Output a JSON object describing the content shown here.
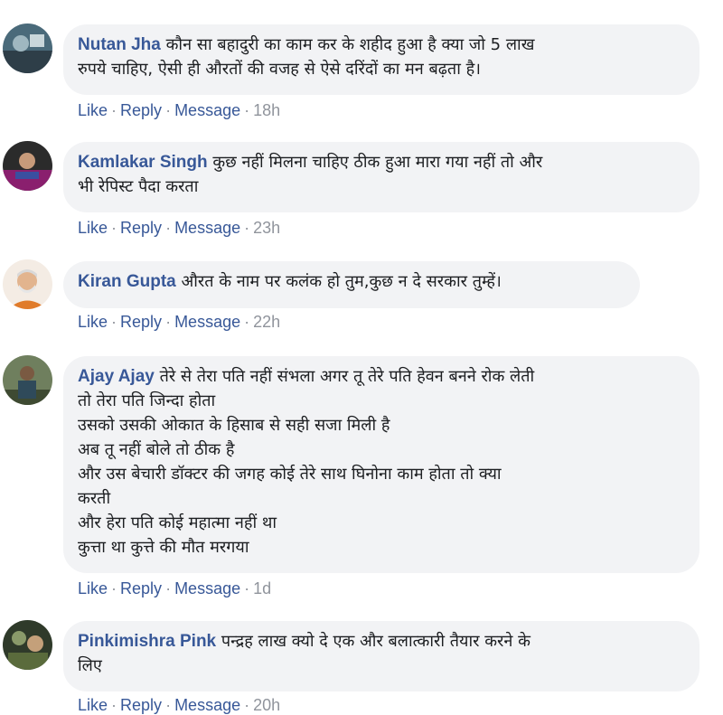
{
  "comments": [
    {
      "author": "Nutan Jha",
      "text": "कौन सा बहादुरी का काम कर के शहीद हुआ है क्या जो 5 लाख\nरुपये चाहिए, ऐसी ही औरतों की वजह से ऐसे दरिंदों का मन बढ़ता है।",
      "like": "Like",
      "reply": "Reply",
      "message": "Message",
      "time": "18h",
      "avatar_icon": "user-avatar-icon"
    },
    {
      "author": "Kamlakar Singh",
      "text": "कुछ नहीं मिलना चाहिए ठीक हुआ मारा गया नहीं तो और\nभी रेपिस्ट पैदा करता",
      "like": "Like",
      "reply": "Reply",
      "message": "Message",
      "time": "23h",
      "avatar_icon": "user-avatar-icon"
    },
    {
      "author": "Kiran Gupta",
      "text": "औरत के नाम पर कलंक हो तुम,कुछ न दे सरकार तुम्हें।",
      "like": "Like",
      "reply": "Reply",
      "message": "Message",
      "time": "22h",
      "avatar_icon": "user-avatar-icon"
    },
    {
      "author": "Ajay Ajay",
      "text": "तेरे से तेरा पति नहीं संभला अगर तू तेरे पति हेवन बनने रोक लेती\nतो तेरा पति जिन्दा होता\nउसको उसकी ओकात के हिसाब से सही सजा मिली है\nअब तू नहीं बोले तो ठीक है\nऔर उस बेचारी डॉक्टर की जगह कोई तेरे साथ घिनोना काम होता तो क्या\nकरती\nऔर हेरा पति कोई महात्मा नहीं था\nकुत्ता था कुत्ते की मौत मरगया",
      "like": "Like",
      "reply": "Reply",
      "message": "Message",
      "time": "1d",
      "avatar_icon": "user-avatar-icon"
    },
    {
      "author": "Pinkimishra Pink",
      "text": "पन्द्रह लाख क्यो दे एक और बलात्कारी तैयार करने के\nलिए",
      "like": "Like",
      "reply": "Reply",
      "message": "Message",
      "time": "20h",
      "avatar_icon": "user-avatar-icon"
    }
  ],
  "separator": "·",
  "colors": {
    "link": "#385898",
    "bubble": "#f2f3f5",
    "meta": "#90949c"
  }
}
